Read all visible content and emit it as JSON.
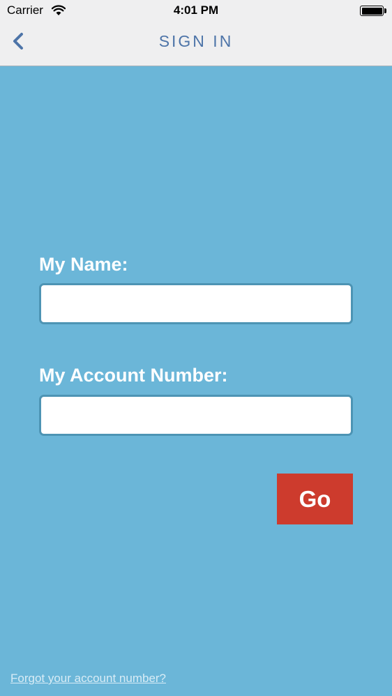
{
  "status_bar": {
    "carrier": "Carrier",
    "time": "4:01 PM",
    "wifi_icon": "wifi-icon",
    "battery_icon": "battery-icon"
  },
  "nav": {
    "title": "SIGN IN",
    "back_icon": "chevron-left-icon",
    "title_color": "#4d74a8"
  },
  "form": {
    "name_label": "My Name:",
    "name_value": "",
    "account_label": "My Account Number:",
    "account_value": "",
    "go_label": "Go"
  },
  "footer": {
    "forgot_link": "Forgot your account number?"
  },
  "colors": {
    "background": "#6bb6d8",
    "button": "#cd3b2d",
    "bar": "#efeff0"
  }
}
